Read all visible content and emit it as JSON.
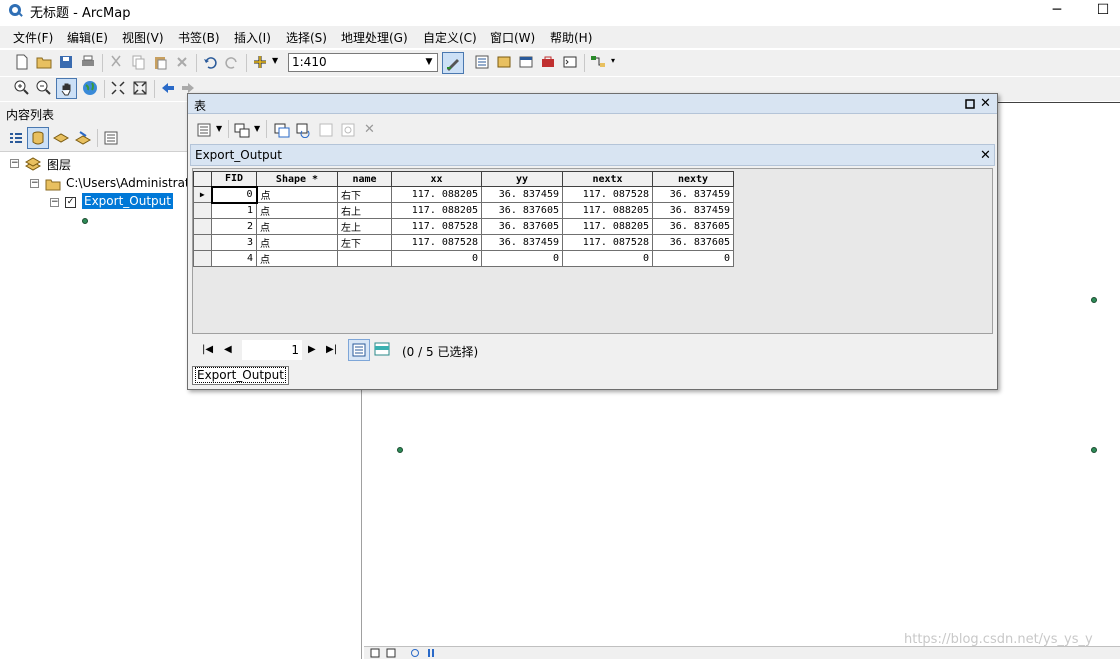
{
  "window": {
    "title": "无标题 - ArcMap",
    "minimize": "─",
    "maximize": "☐"
  },
  "menu": [
    "文件(F)",
    "编辑(E)",
    "视图(V)",
    "书签(B)",
    "插入(I)",
    "选择(S)",
    "地理处理(G)",
    "自定义(C)",
    "窗口(W)",
    "帮助(H)"
  ],
  "toolbar": {
    "scale": "1:410"
  },
  "toc": {
    "title": "内容列表",
    "root": "图层",
    "folder": "C:\\Users\\Administrat",
    "layer": "Export_Output"
  },
  "table_window": {
    "title": "表",
    "tab_title": "Export_Output",
    "columns": [
      "FID",
      "Shape *",
      "name",
      "xx",
      "yy",
      "nextx",
      "nexty"
    ],
    "rows": [
      [
        "0",
        "点",
        "右下",
        "117. 088205",
        "36. 837459",
        "117. 087528",
        "36. 837459"
      ],
      [
        "1",
        "点",
        "右上",
        "117. 088205",
        "36. 837605",
        "117. 088205",
        "36. 837459"
      ],
      [
        "2",
        "点",
        "左上",
        "117. 087528",
        "36. 837605",
        "117. 088205",
        "36. 837605"
      ],
      [
        "3",
        "点",
        "左下",
        "117. 087528",
        "36. 837459",
        "117. 087528",
        "36. 837605"
      ],
      [
        "4",
        "点",
        "",
        "0",
        "0",
        "0",
        "0"
      ]
    ],
    "page": "1",
    "selection": "(0 / 5 已选择)",
    "bottom_tab": "Export_Output"
  },
  "watermark": "https://blog.csdn.net/ys_ys_y",
  "colors": {
    "selection": "#0078d7",
    "header": "#d8e4f2",
    "point": "#2e8b57"
  }
}
